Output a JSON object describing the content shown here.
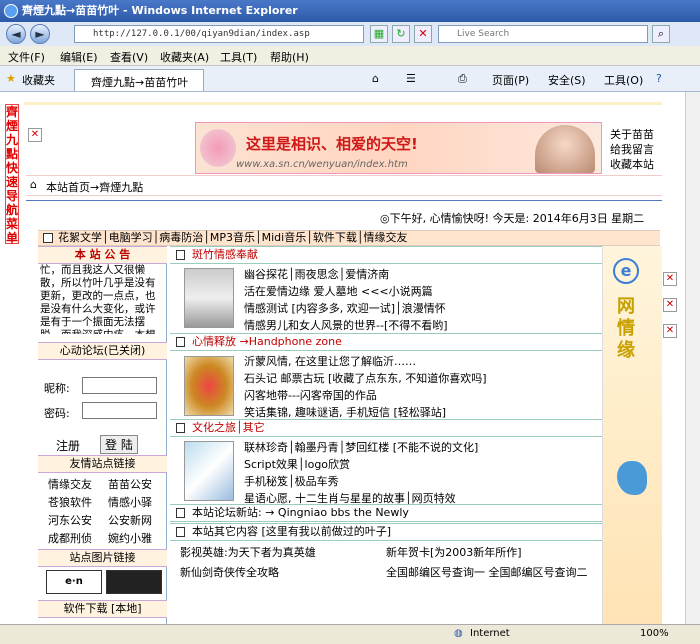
{
  "window": {
    "title": "齊煙九點→苗苗竹叶 - Windows Internet Explorer"
  },
  "nav": {
    "address": "http://127.0.0.1/00/qiyan9dian/index.asp",
    "search_placeholder": "Live Search"
  },
  "menu": [
    "文件(F)",
    "编辑(E)",
    "查看(V)",
    "收藏夹(A)",
    "工具(T)",
    "帮助(H)"
  ],
  "favbar": {
    "favorites": "收藏夹",
    "tab": "齊煙九點→苗苗竹叶",
    "page": "页面(P)",
    "safety": "安全(S)",
    "tools": "工具(O)"
  },
  "side_nav": "齊煙九點快速导航菜单",
  "banner": {
    "text": "这里是相识、相爱的天空!",
    "url": "www.xa.sn.cn/wenyuan/index.htm"
  },
  "top_links": [
    "关于苗苗",
    "给我留言",
    "收藏本站"
  ],
  "breadcrumb": "本站首页→齊煙九點",
  "welcome": "◎下午好, 心情愉快呀!  今天是: 2014年6月3日 星期二",
  "categories": "花絮文学│电脑学习│病毒防治│MP3音乐│Midi音乐│软件下载│情缘交友",
  "left": {
    "notice_title": "本 站 公 告",
    "notice_text": "忙，而且我这人又很懒散，所以竹叶几乎是没有更新，更改的一点点，也是没有什么大变化，或许是有于一个振面无法摆脱，而我深感内疚，本想",
    "forum_title": "心动论坛(已关闭)",
    "nick_label": "昵称:",
    "pass_label": "密码:",
    "register": "注册",
    "login": "登 陆",
    "friends_title": "友情站点链接",
    "friends": [
      [
        "情缘交友",
        "苗苗公安"
      ],
      [
        "苍狼软件",
        "情感小驿"
      ],
      [
        "河东公安",
        "公安新网"
      ],
      [
        "成都刑侦",
        "婉约小雅"
      ]
    ],
    "pics_title": "站点图片链接",
    "software_title": "软件下载 [本地]"
  },
  "center": {
    "s1_title": "斑竹情感奉献",
    "s1_lines": [
      "幽谷探花│雨夜思念│爱情济南",
      "活在爱情边缘 爱人墓地 <<<小说两篇",
      "情感测试 [内容多多, 欢迎一试]│浪漫情怀",
      "情感男儿和女人风景的世界--[不得不看哟]"
    ],
    "s2_title": "心情释放 →Handphone zone",
    "s2_lines": [
      "沂蒙风情, 在这里让您了解临沂……",
      "石头记 邮票古玩 [收藏了点东东, 不知道你喜欢吗]",
      "闪客地带---闪客帝国的作品",
      "笑话集锦, 趣味谜语, 手机短信 [轻松驿站]"
    ],
    "s3_title": "文化之旅│其它",
    "s3_lines": [
      "联林珍奇│翰墨丹青│梦回红楼 [不能不说的文化]",
      "Script效果│logo欣赏",
      "手机秘笈│极品车秀",
      "星语心愿, 十二生肖与星星的故事│网页特效"
    ],
    "forum_new": "本站论坛新站: → Qingniao bbs the Newly",
    "other_title": "本站其它内容  [这里有我以前做过的叶子]",
    "other_items": [
      "影视英雄:为天下者为真英雄",
      "新年贺卡[为2003新年所作]",
      "新仙剑奇侠传全攻略",
      "全国邮编区号查询一 全国邮编区号查询二"
    ]
  },
  "right": {
    "vertical": "网情缘"
  },
  "status": {
    "zone": "Internet",
    "zoom": "100%"
  }
}
